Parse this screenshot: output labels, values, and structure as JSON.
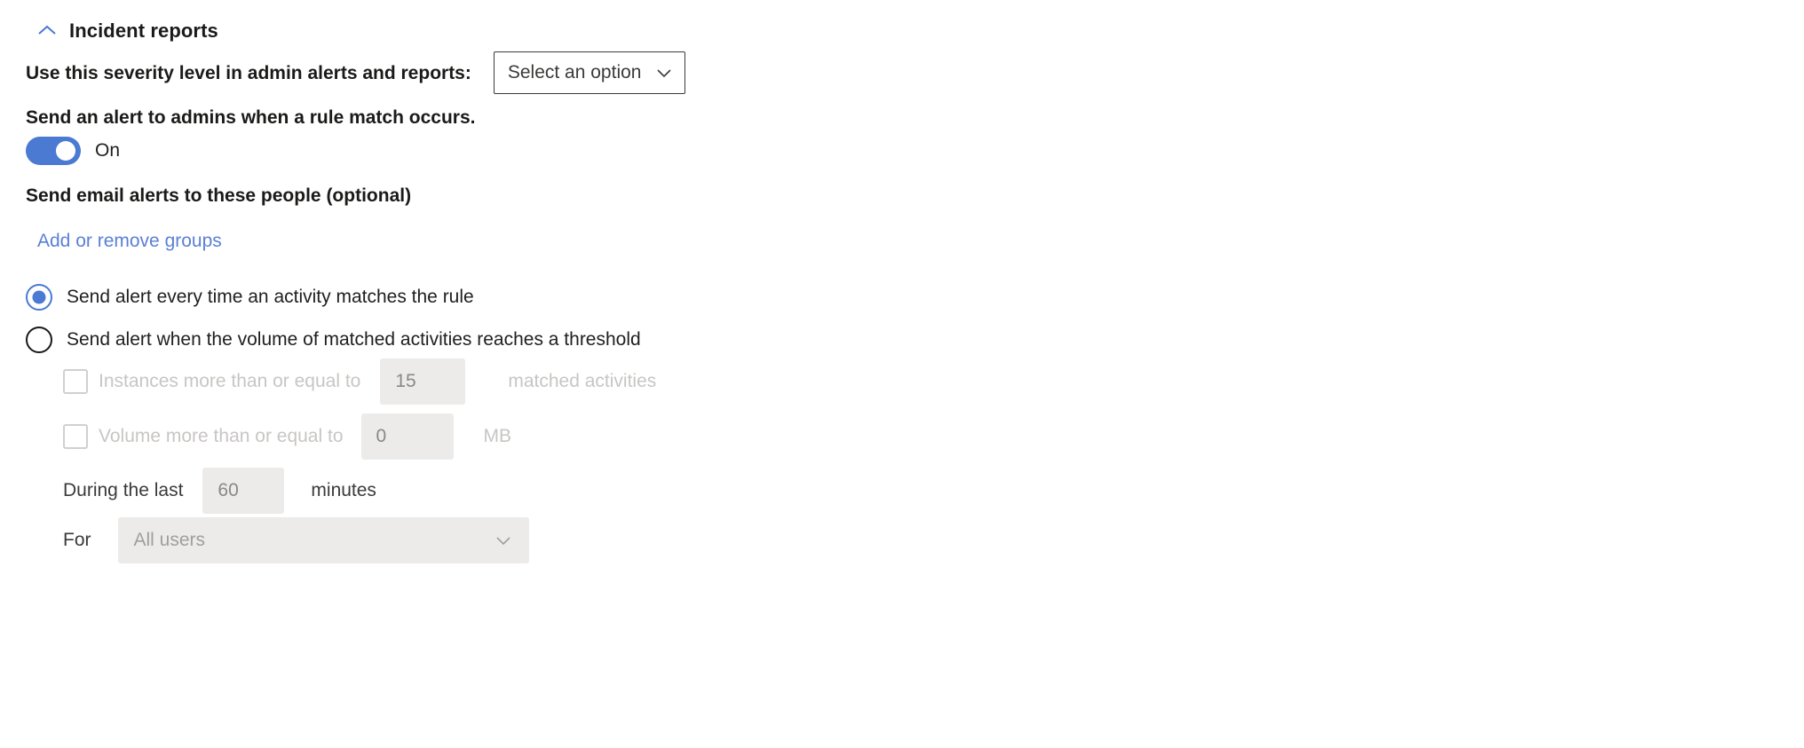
{
  "section": {
    "title": "Incident reports",
    "collapse_icon": "chevron-up-icon"
  },
  "severity": {
    "label": "Use this severity level in admin alerts and reports:",
    "dropdown_value": "Select an option",
    "dropdown_icon": "chevron-down-icon"
  },
  "admin_alert": {
    "label": "Send an alert to admins when a rule match occurs.",
    "toggle_state": "On"
  },
  "email_alerts": {
    "label": "Send email alerts to these people (optional)",
    "link": "Add or remove groups"
  },
  "alert_mode": {
    "options": [
      {
        "label": "Send alert every time an activity matches the rule",
        "selected": true
      },
      {
        "label": "Send alert when the volume of matched activities reaches a threshold",
        "selected": false
      }
    ]
  },
  "threshold": {
    "instances": {
      "checkbox_label": "Instances more than or equal to",
      "value": "15",
      "unit": "matched activities",
      "checked": false
    },
    "volume": {
      "checkbox_label": "Volume more than or equal to",
      "value": "0",
      "unit": "MB",
      "checked": false
    },
    "duration": {
      "label": "During the last",
      "value": "60",
      "unit": "minutes"
    },
    "audience": {
      "label": "For",
      "value": "All users",
      "dropdown_icon": "chevron-down-icon"
    }
  },
  "colors": {
    "accent_blue": "#4a7ad2",
    "link_blue": "#5b80d6",
    "disabled_fill": "#edebe9",
    "disabled_text": "#c8c6c4"
  }
}
